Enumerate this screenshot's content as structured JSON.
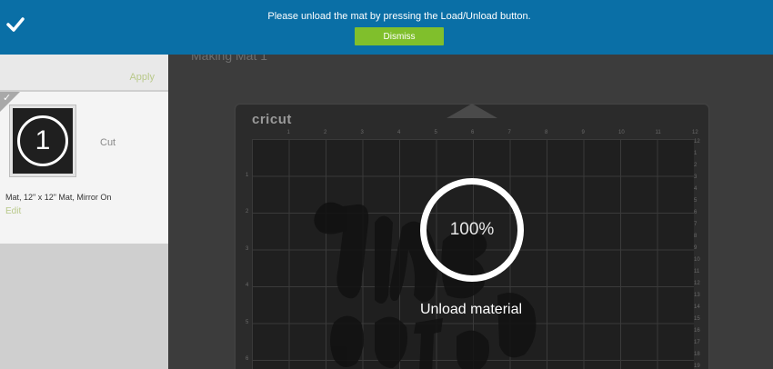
{
  "banner": {
    "message": "Please unload the mat by pressing the Load/Unload button.",
    "dismiss_label": "Dismiss",
    "check_icon": "check-icon"
  },
  "sidebar": {
    "apply_label": "Apply",
    "mat_card": {
      "mat_number": "1",
      "action_label": "Cut",
      "description": "Mat, 12\" x 12\" Mat, Mirror On",
      "edit_label": "Edit"
    }
  },
  "main": {
    "title": "Making Mat 1",
    "brand": "cricut",
    "ruler_top": [
      "1",
      "2",
      "3",
      "4",
      "5",
      "6",
      "7",
      "8",
      "9",
      "10",
      "11",
      "12"
    ],
    "ruler_left": [
      "1",
      "2",
      "3",
      "4",
      "5",
      "6"
    ],
    "ruler_right": [
      "12",
      "1",
      "2",
      "3",
      "4",
      "5",
      "6",
      "7",
      "8",
      "9",
      "10",
      "11",
      "12",
      "13",
      "14",
      "15",
      "16",
      "17",
      "18",
      "19"
    ],
    "progress": "100%",
    "status": "Unload material"
  },
  "colors": {
    "banner": "#0a6fa6",
    "dismiss": "#80bf2c",
    "link": "#b9c98a"
  }
}
